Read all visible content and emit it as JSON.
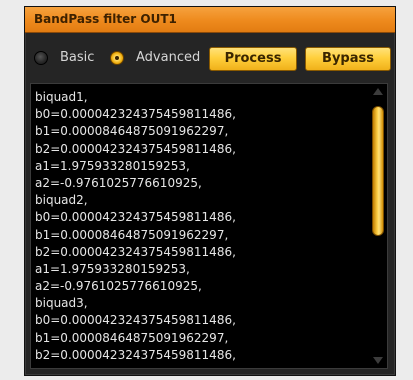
{
  "window": {
    "title": "BandPass filter OUT1"
  },
  "mode": {
    "options": [
      {
        "label": "Basic",
        "selected": false
      },
      {
        "label": "Advanced",
        "selected": true
      }
    ]
  },
  "toolbar": {
    "process_label": "Process",
    "bypass_label": "Bypass"
  },
  "coefficients": {
    "lines": [
      "biquad1,",
      "b0=0.000042324375459811486,",
      "b1=0.00008464875091962297,",
      "b2=0.000042324375459811486,",
      "a1=1.975933280159253,",
      "a2=-0.9761025776610925,",
      "biquad2,",
      "b0=0.000042324375459811486,",
      "b1=0.00008464875091962297,",
      "b2=0.000042324375459811486,",
      "a1=1.975933280159253,",
      "a2=-0.9761025776610925,",
      "biquad3,",
      "b0=0.000042324375459811486,",
      "b1=0.00008464875091962297,",
      "b2=0.000042324375459811486,"
    ]
  },
  "colors": {
    "accent": "#f0a030",
    "button": "#ffcf3c",
    "panel": "#252525",
    "text_area": "#000000"
  },
  "icons": {
    "radio_off": "radio-unselected-icon",
    "radio_on": "radio-selected-icon",
    "scroll_up": "scroll-up-arrow-icon",
    "scroll_down": "scroll-down-arrow-icon"
  }
}
